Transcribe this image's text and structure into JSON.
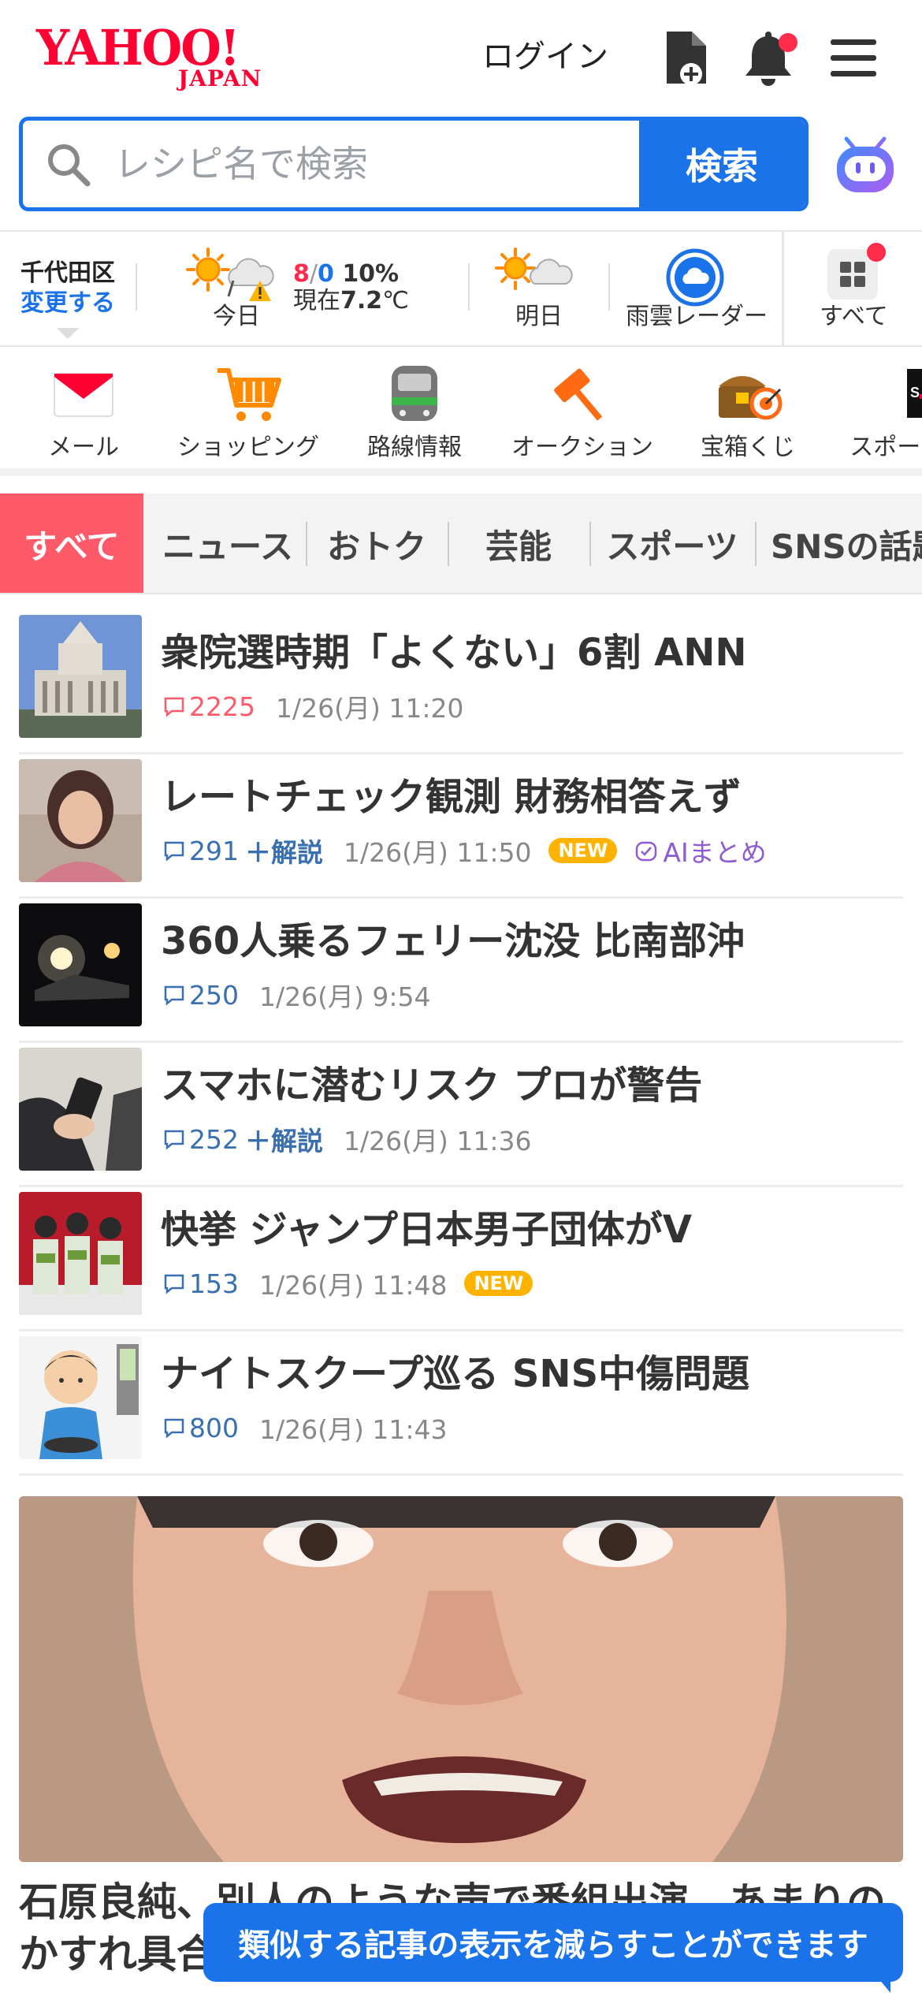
{
  "header": {
    "logo_main": "YAHOO!",
    "logo_sub": "JAPAN",
    "login_label": "ログイン",
    "icons": [
      "file-plus-icon",
      "bell-icon",
      "hamburger-menu-icon"
    ]
  },
  "search": {
    "placeholder": "レシピ名で検索",
    "button_label": "検索"
  },
  "weather": {
    "location": "千代田区",
    "change_label": "変更する",
    "today_label": "今日",
    "high": "8",
    "slash": "/",
    "low": "0",
    "rain": "10%",
    "now_prefix": "現在",
    "now_temp": "7.2",
    "now_unit": "℃",
    "tomorrow_label": "明日",
    "radar_label": "雨雲レーダー",
    "all_label": "すべて"
  },
  "services": [
    {
      "label": "メール",
      "icon": "mail-icon"
    },
    {
      "label": "ショッピング",
      "icon": "shopping-cart-icon"
    },
    {
      "label": "路線情報",
      "icon": "train-icon"
    },
    {
      "label": "オークション",
      "icon": "auction-hammer-icon"
    },
    {
      "label": "宝箱くじ",
      "icon": "treasure-box-icon"
    },
    {
      "label": "スポーツ",
      "icon": "sports-icon"
    }
  ],
  "tabs": [
    "すべて",
    "ニュース",
    "おトク",
    "芸能",
    "スポーツ",
    "SNSの話題"
  ],
  "news": [
    {
      "headline": "衆院選時期「よくない」6割 ANN",
      "comments": "2225",
      "date": "1/26(月) 11:20",
      "hot": true
    },
    {
      "headline": "レートチェック観測 財務相答えず",
      "comments": "291",
      "kaisetsu": "＋解説",
      "date": "1/26(月) 11:50",
      "new": "NEW",
      "ai": "AIまとめ"
    },
    {
      "headline": "360人乗るフェリー沈没 比南部沖",
      "comments": "250",
      "date": "1/26(月) 9:54"
    },
    {
      "headline": "スマホに潜むリスク プロが警告",
      "comments": "252",
      "kaisetsu": "＋解説",
      "date": "1/26(月) 11:36"
    },
    {
      "headline": "快挙 ジャンプ日本男子団体がV",
      "comments": "153",
      "date": "1/26(月) 11:48",
      "new": "NEW"
    },
    {
      "headline": "ナイトスクープ巡る SNS中傷問題",
      "comments": "800",
      "date": "1/26(月) 11:43"
    }
  ],
  "feature": {
    "title": "石原良純、別人のような声で番組出演　あまりのかすれ具合に"
  },
  "toast": "類似する記事の表示を減らすことができます",
  "colors": {
    "brand_red": "#ff0033",
    "accent_blue": "#1a73e8",
    "tab_active": "#ff5a6a",
    "new_badge": "#ffb300"
  }
}
